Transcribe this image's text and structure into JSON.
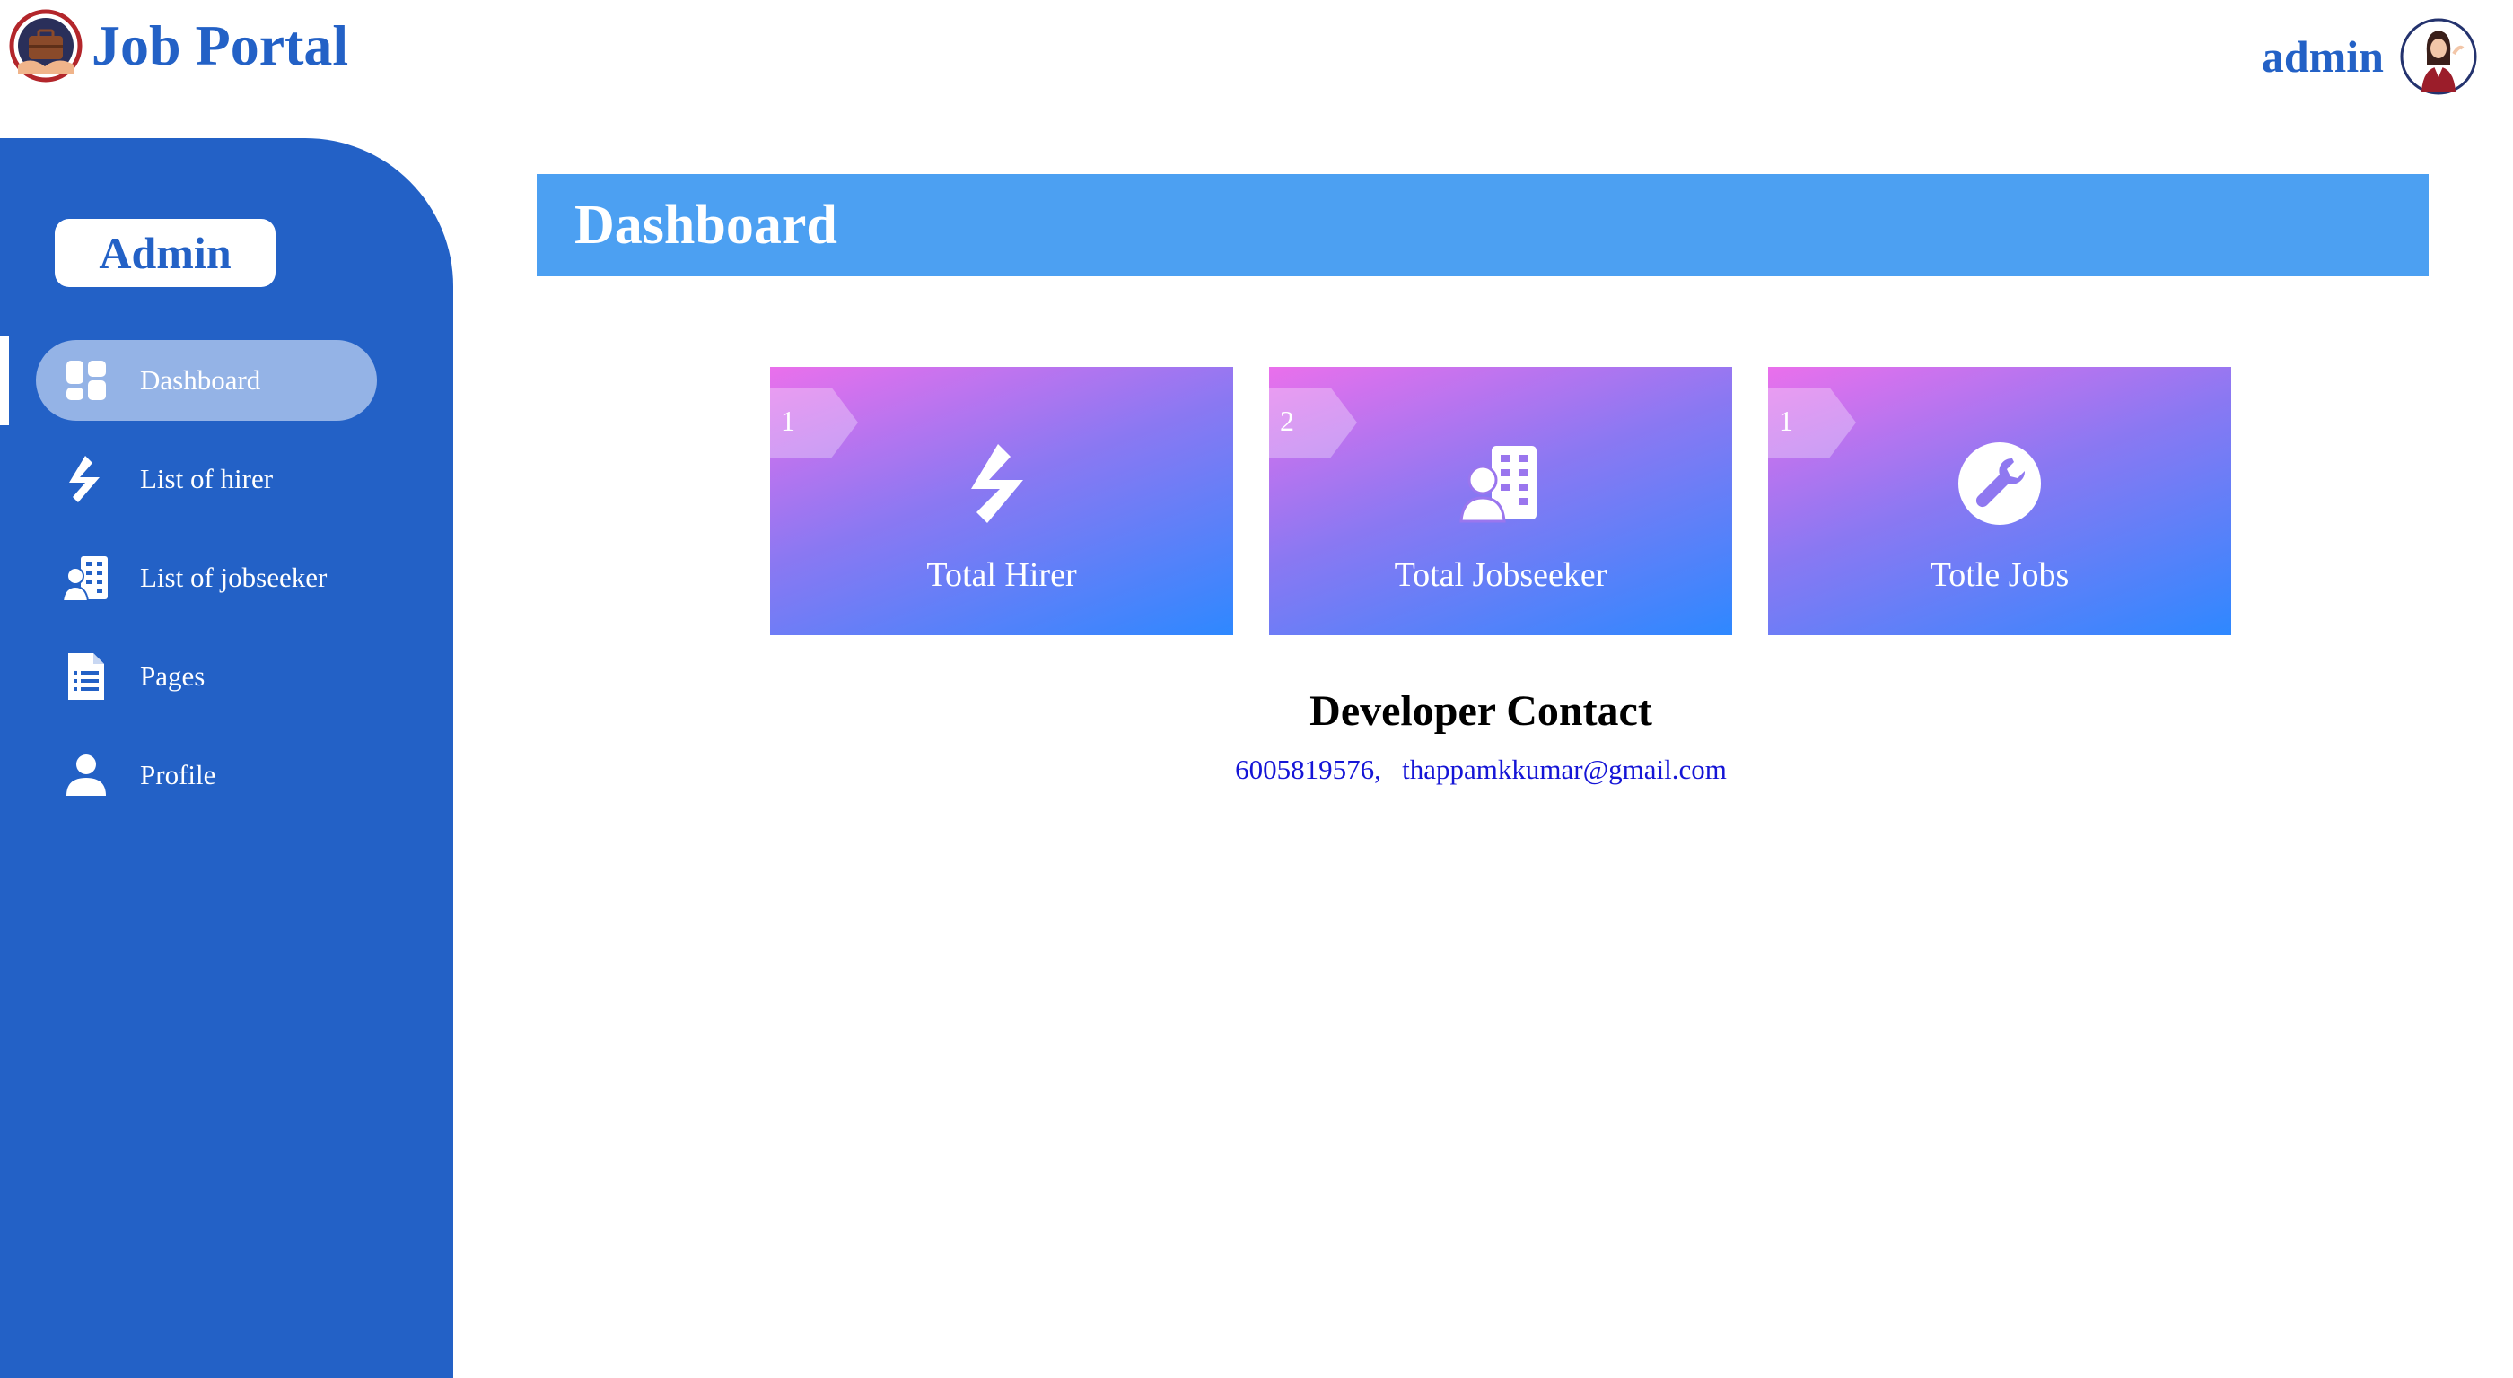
{
  "header": {
    "brand_title": "Job Portal",
    "user_name": "admin"
  },
  "sidebar": {
    "badge": "Admin",
    "items": [
      {
        "label": "Dashboard",
        "icon": "dashboard-grid-icon",
        "active": true
      },
      {
        "label": "List of hirer",
        "icon": "toptal-icon",
        "active": false
      },
      {
        "label": "List of jobseeker",
        "icon": "building-user-icon",
        "active": false
      },
      {
        "label": "Pages",
        "icon": "document-list-icon",
        "active": false
      },
      {
        "label": "Profile",
        "icon": "user-icon",
        "active": false
      }
    ]
  },
  "main": {
    "title": "Dashboard",
    "cards": [
      {
        "count": "1",
        "label": "Total Hirer",
        "icon": "toptal-icon"
      },
      {
        "count": "2",
        "label": "Total Jobseeker",
        "icon": "building-user-icon"
      },
      {
        "count": "1",
        "label": "Totle Jobs",
        "icon": "wrench-icon"
      }
    ],
    "developer": {
      "title": "Developer Contact",
      "phone": "6005819576",
      "separator": ",",
      "email": "thappamkkumar@gmail.com"
    }
  },
  "colors": {
    "primary": "#2361c6",
    "header_bar": "#4ca0f2",
    "active_item": "#94b3e6",
    "card_gradient_start": "#ea70ec",
    "card_gradient_end": "#2e88ff",
    "link": "#1515d6"
  }
}
